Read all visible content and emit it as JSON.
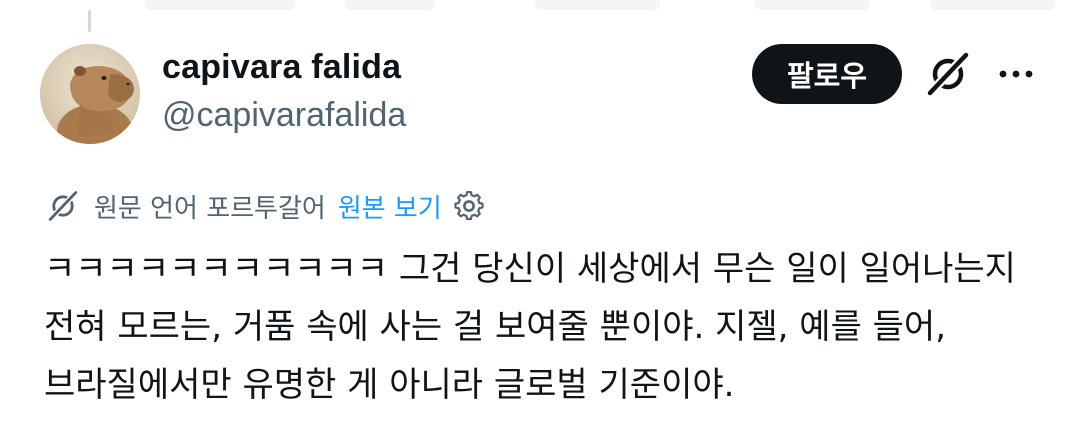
{
  "author": {
    "display_name": "capivara falida",
    "handle": "@capivarafalida"
  },
  "actions": {
    "follow_label": "팔로우",
    "grok_icon": "grok-icon",
    "more_icon": "more-icon"
  },
  "translation": {
    "label": "원문 언어 포르투갈어",
    "view_original_label": "원본 보기",
    "icon": "grok-translate-icon",
    "settings_icon": "gear-icon"
  },
  "tweet": {
    "text": "ㅋㅋㅋㅋㅋㅋㅋㅋㅋㅋㅋ 그건 당신이 세상에서 무슨 일이 일어나는지 전혀 모르는, 거품 속에 사는 걸 보여줄 뿐이야. 지젤, 예를 들어, 브라질에서만 유명한 게 아니라 글로벌 기준이야."
  },
  "colors": {
    "text": "#0f1419",
    "secondary": "#536471",
    "link": "#1d9bf0",
    "button_bg": "#0f1419"
  }
}
